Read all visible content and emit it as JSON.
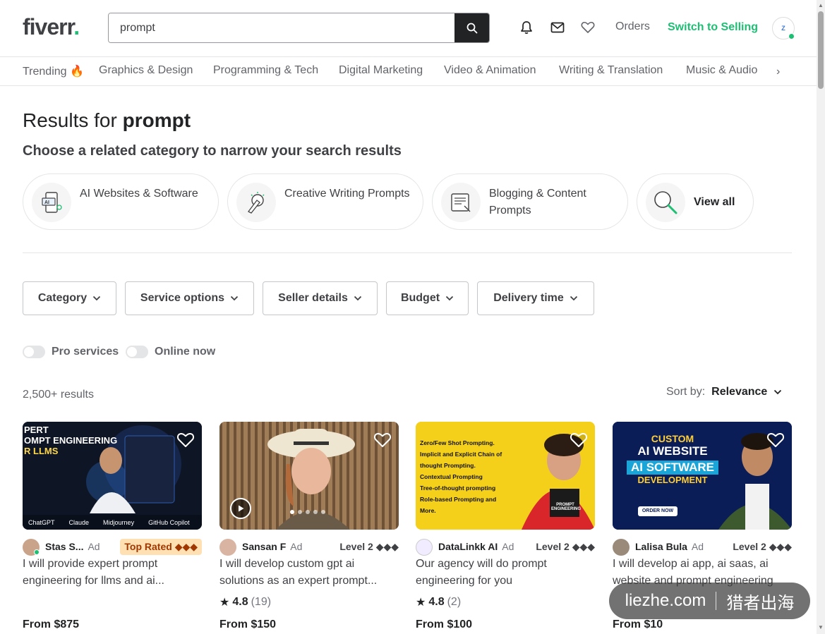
{
  "header": {
    "logo": "fiverr",
    "logo_dot": ".",
    "search_value": "prompt",
    "orders": "Orders",
    "switch": "Switch to Selling",
    "avatar_text": "Z"
  },
  "categories_nav": [
    "Trending 🔥",
    "Graphics & Design",
    "Programming & Tech",
    "Digital Marketing",
    "Video & Animation",
    "Writing & Translation",
    "Music & Audio"
  ],
  "results": {
    "prefix": "Results for",
    "query": "prompt"
  },
  "choose_heading": "Choose a related category to narrow your search results",
  "related": [
    {
      "label": "AI Websites & Software"
    },
    {
      "label": "Creative Writing Prompts"
    },
    {
      "label": "Blogging & Content Prompts"
    },
    {
      "label": "View all"
    }
  ],
  "filters": [
    "Category",
    "Service options",
    "Seller details",
    "Budget",
    "Delivery time"
  ],
  "toggles": [
    "Pro services",
    "Online now"
  ],
  "count": "2,500+ results",
  "sort": {
    "label": "Sort by:",
    "value": "Relevance"
  },
  "gigs": [
    {
      "seller": "Stas S...",
      "ad": "Ad",
      "badge": "Top Rated ◆◆◆",
      "title": "I will provide expert prompt engineering for llms and ai...",
      "rating": "",
      "reviews": "",
      "price": "From $875",
      "thumb_text": [
        "PERT",
        "OMPT ENGINEERING",
        "R LLMS"
      ],
      "thumb_logos": [
        "ChatGPT",
        "Claude",
        "Midjourney",
        "GitHub Copilot"
      ]
    },
    {
      "seller": "Sansan F",
      "ad": "Ad",
      "badge": "Level 2 ◆◆◆",
      "title": "I will develop custom gpt ai solutions as an expert prompt...",
      "rating": "4.8",
      "reviews": "(19)",
      "price": "From $150"
    },
    {
      "seller": "DataLinkk AI",
      "ad": "Ad",
      "badge": "Level 2 ◆◆◆",
      "title": "Our agency will do prompt engineering for you",
      "rating": "4.8",
      "reviews": "(2)",
      "price": "From $100",
      "thumb_list": [
        "Zero/Few Shot Prompting.",
        "Implicit and Explicit Chain of thought Prompting.",
        "Contextual Prompting",
        "Tree-of-thought prompting",
        "Role-based Prompting and More."
      ],
      "thumb_caption": "PROMPT ENGINEERING"
    },
    {
      "seller": "Lalisa Bula",
      "ad": "Ad",
      "badge": "Level 2 ◆◆◆",
      "title": "I will develop ai app, ai saas, ai website and prompt engineering",
      "rating": "",
      "reviews": "",
      "price": "From $10",
      "thumb_text": [
        "CUSTOM",
        "AI WEBSITE",
        "AI SOFTWARE",
        "DEVELOPMENT"
      ],
      "thumb_cta": "ORDER NOW"
    }
  ],
  "watermark": {
    "left": "liezhe.com",
    "right": "猎者出海"
  }
}
